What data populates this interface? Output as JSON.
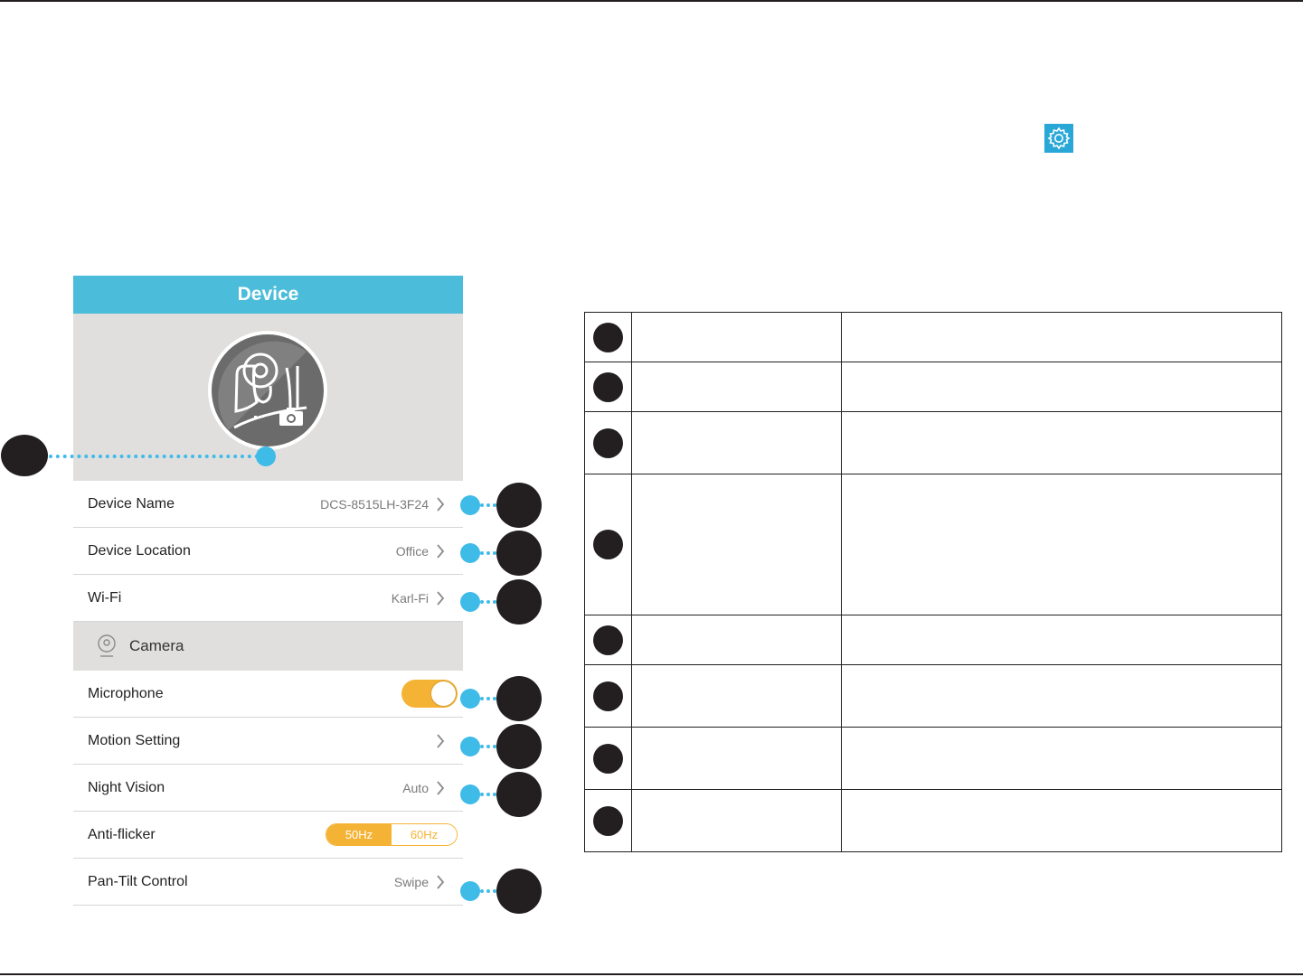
{
  "panel": {
    "title": "Device",
    "rows_top": [
      {
        "label": "Device Name",
        "value": "DCS-8515LH-3F24"
      },
      {
        "label": "Device Location",
        "value": "Office"
      },
      {
        "label": "Wi-Fi",
        "value": "Karl-Fi"
      }
    ],
    "section": {
      "label": "Camera",
      "icon": "camera-icon"
    },
    "rows_bottom": {
      "microphone": {
        "label": "Microphone",
        "toggle_on": true
      },
      "motion": {
        "label": "Motion Setting"
      },
      "night_vision": {
        "label": "Night Vision",
        "value": "Auto"
      },
      "anti_flicker": {
        "label": "Anti-flicker",
        "options": [
          "50Hz",
          "60Hz"
        ],
        "selected": "50Hz"
      },
      "pan_tilt": {
        "label": "Pan-Tilt Control",
        "value": "Swipe"
      }
    }
  },
  "colors": {
    "header": "#4bbcda",
    "accent": "#f5b335",
    "callout": "#3fbbe8",
    "badge": "#231f20",
    "gear": "#29a8d8"
  },
  "icons": [
    "gear-icon",
    "camera-avatar-icon",
    "chevron-right-icon",
    "camera-icon"
  ]
}
